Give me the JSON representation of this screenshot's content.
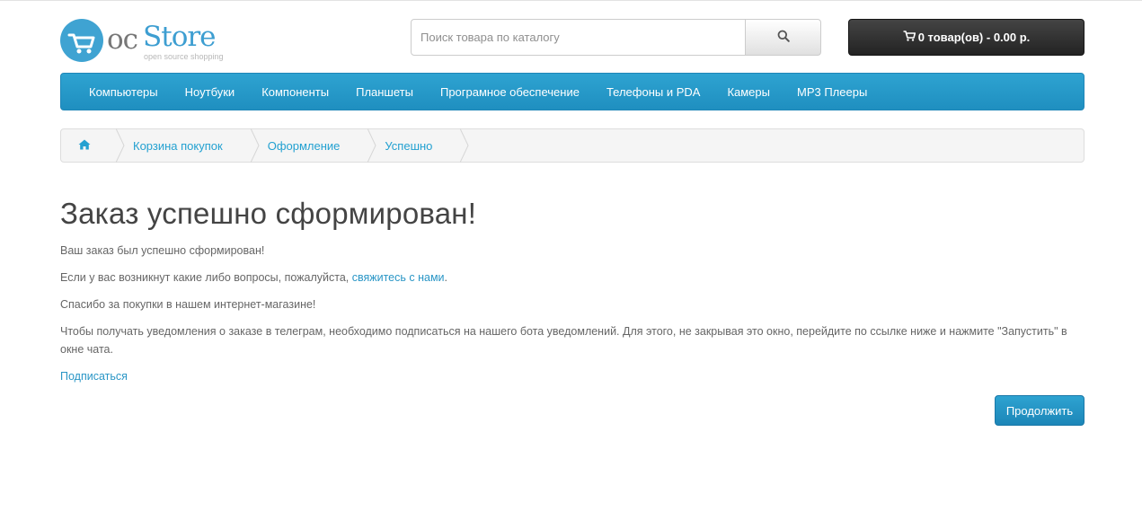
{
  "logo": {
    "oc": "oc",
    "store": "Store",
    "tagline": "open source shopping"
  },
  "search": {
    "placeholder": "Поиск товара по каталогу",
    "value": ""
  },
  "cart": {
    "label": "0 товар(ов) - 0.00 р."
  },
  "menu": {
    "items": [
      {
        "label": "Компьютеры"
      },
      {
        "label": "Ноутбуки"
      },
      {
        "label": "Компоненты"
      },
      {
        "label": "Планшеты"
      },
      {
        "label": "Програмное обеспечение"
      },
      {
        "label": "Телефоны и PDA"
      },
      {
        "label": "Камеры"
      },
      {
        "label": "MP3 Плееры"
      }
    ]
  },
  "breadcrumb": {
    "items": [
      {
        "label": "Корзина покупок"
      },
      {
        "label": "Оформление"
      },
      {
        "label": "Успешно"
      }
    ]
  },
  "content": {
    "title": "Заказ успешно сформирован!",
    "p1": "Ваш заказ был успешно сформирован!",
    "p2_before": "Если у вас возникнут какие либо вопросы, пожалуйста, ",
    "p2_link": "свяжитесь с нами",
    "p2_after": ".",
    "p3": "Спасибо за покупки в нашем интернет-магазине!",
    "p4": "Чтобы получать уведомления о заказе в телеграм, необходимо подписаться на нашего бота уведомлений. Для этого, не закрывая это окно, перейдите по ссылке ниже и нажмите \"Запустить\" в окне чата.",
    "subscribe_link": "Подписаться",
    "continue_button": "Продолжить"
  },
  "colors": {
    "accent": "#2ea3d1",
    "link": "#2a96c6",
    "cart_bg": "#2f2f2f"
  },
  "icons": {
    "search": "search-icon",
    "cart": "cart-icon",
    "home": "home-icon"
  }
}
